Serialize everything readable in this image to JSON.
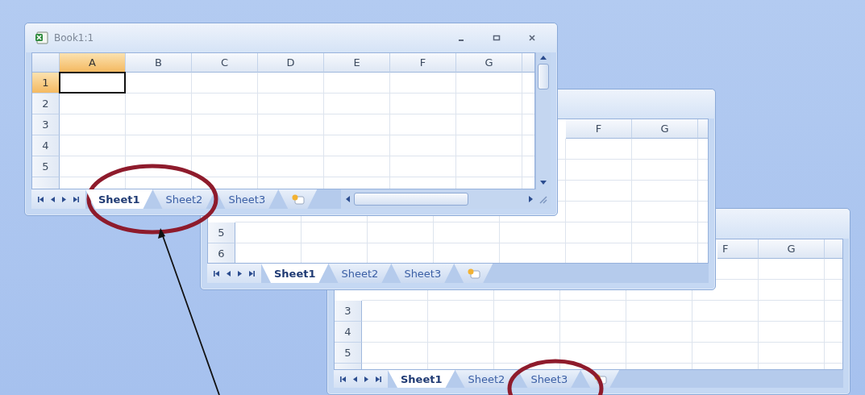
{
  "windows": [
    {
      "title": "Book1:1",
      "columns": [
        {
          "label": "A",
          "selected": true
        },
        {
          "label": "B",
          "selected": false
        },
        {
          "label": "C",
          "selected": false
        },
        {
          "label": "D",
          "selected": false
        },
        {
          "label": "E",
          "selected": false
        },
        {
          "label": "F",
          "selected": false
        },
        {
          "label": "G",
          "selected": false
        }
      ],
      "rows": [
        {
          "label": "1",
          "selected": true
        },
        {
          "label": "2",
          "selected": false
        },
        {
          "label": "3",
          "selected": false
        },
        {
          "label": "4",
          "selected": false
        },
        {
          "label": "5",
          "selected": false
        }
      ],
      "tabs": [
        {
          "label": "Sheet1",
          "selected": true
        },
        {
          "label": "Sheet2",
          "selected": false
        },
        {
          "label": "Sheet3",
          "selected": false
        }
      ]
    },
    {
      "columns": [
        {
          "label": "F",
          "selected": false
        },
        {
          "label": "G",
          "selected": false
        }
      ],
      "rows": [
        {
          "label": "5",
          "selected": false
        },
        {
          "label": "6",
          "selected": false
        }
      ],
      "tabs": [
        {
          "label": "Sheet1",
          "selected": true
        },
        {
          "label": "Sheet2",
          "selected": false
        },
        {
          "label": "Sheet3",
          "selected": false
        }
      ]
    },
    {
      "columns": [
        {
          "label": "F",
          "selected": false
        },
        {
          "label": "G",
          "selected": false
        }
      ],
      "rows": [
        {
          "label": "3",
          "selected": false
        },
        {
          "label": "4",
          "selected": false
        },
        {
          "label": "5",
          "selected": false
        }
      ],
      "tabs": [
        {
          "label": "Sheet1",
          "selected": true
        },
        {
          "label": "Sheet2",
          "selected": false
        },
        {
          "label": "Sheet3",
          "selected": false
        }
      ]
    }
  ]
}
